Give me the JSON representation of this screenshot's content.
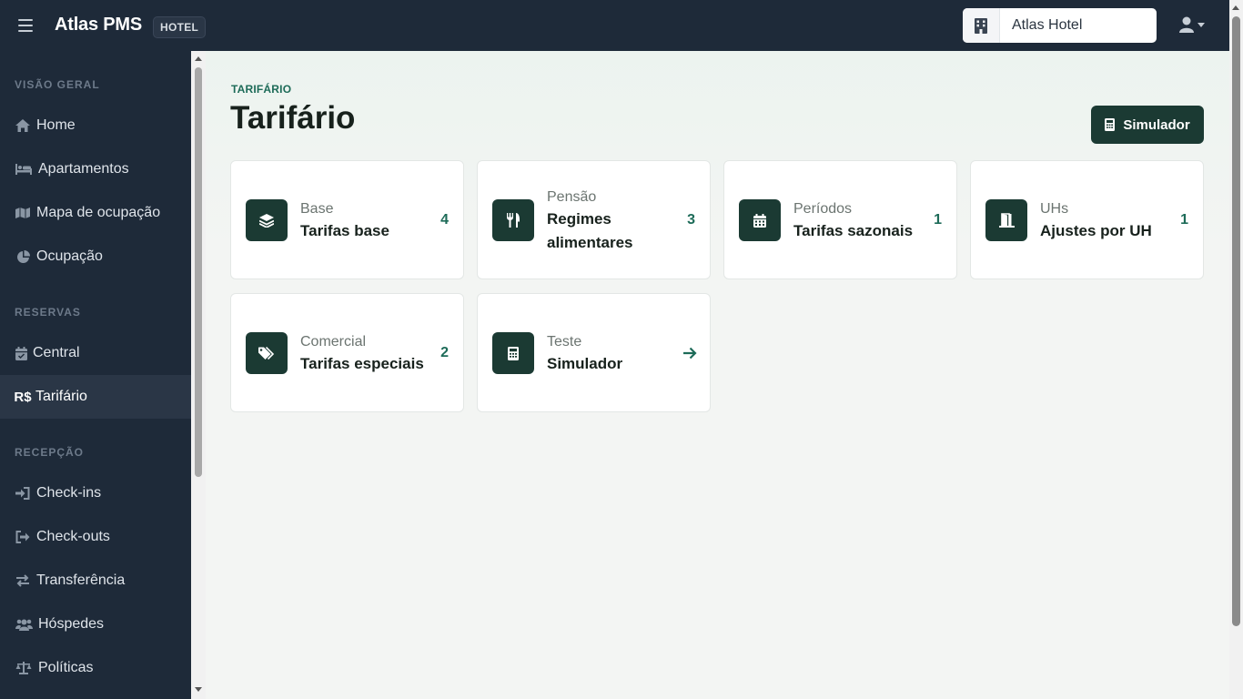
{
  "topbar": {
    "brand": "Atlas PMS",
    "badge": "HOTEL",
    "hotel_name": "Atlas Hotel"
  },
  "sidebar": {
    "sections": [
      {
        "title": "VISÃO GERAL"
      },
      {
        "title": "RESERVAS"
      },
      {
        "title": "RECEPÇÃO"
      }
    ],
    "items": [
      {
        "label": "Home",
        "icon": "home-icon"
      },
      {
        "label": "Apartamentos",
        "icon": "bed-icon"
      },
      {
        "label": "Mapa de ocupação",
        "icon": "map-icon"
      },
      {
        "label": "Ocupação",
        "icon": "pie-chart-icon"
      },
      {
        "label": "Central",
        "icon": "calendar-check-icon"
      },
      {
        "label": "Tarifário",
        "icon": "currency-real-icon",
        "active": true
      },
      {
        "label": "Check-ins",
        "icon": "sign-in-icon"
      },
      {
        "label": "Check-outs",
        "icon": "sign-out-icon"
      },
      {
        "label": "Transferência",
        "icon": "exchange-icon"
      },
      {
        "label": "Hóspedes",
        "icon": "users-icon"
      },
      {
        "label": "Políticas",
        "icon": "scale-icon"
      }
    ],
    "currency_symbol": "R$"
  },
  "main": {
    "breadcrumb": "TARIFÁRIO",
    "title": "Tarifário",
    "simulator_button": "Simulador",
    "cards": [
      {
        "subtitle": "Base",
        "title": "Tarifas base",
        "count": "4",
        "icon": "layers-icon"
      },
      {
        "subtitle": "Pensão",
        "title": "Regimes alimentares",
        "count": "3",
        "icon": "utensils-icon"
      },
      {
        "subtitle": "Períodos",
        "title": "Tarifas sazonais",
        "count": "1",
        "icon": "calendar-icon"
      },
      {
        "subtitle": "UHs",
        "title": "Ajustes por UH",
        "count": "1",
        "icon": "door-open-icon"
      },
      {
        "subtitle": "Comercial",
        "title": "Tarifas especiais",
        "count": "2",
        "icon": "tags-icon"
      },
      {
        "subtitle": "Teste",
        "title": "Simulador",
        "icon": "calculator-icon",
        "action": "arrow-right-icon"
      }
    ]
  },
  "colors": {
    "sidebar_bg": "#1e2a39",
    "accent": "#1b3a33",
    "count_green": "#1d6b58"
  }
}
